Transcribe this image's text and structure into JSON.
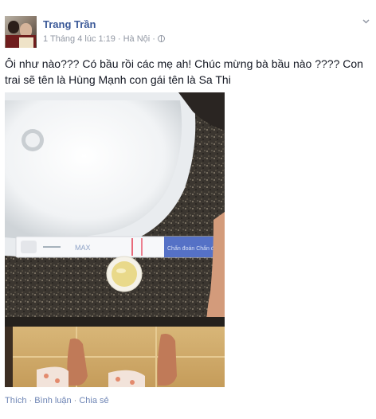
{
  "post": {
    "author": "Trang Trần",
    "date": "1 Tháng 4 lúc 1:19",
    "separator": "·",
    "location": "Hà Nội",
    "status_text": "Ôi như nào??? Có bầu rồi các mẹ ah! Chúc mừng bà bầu nào ???? Con trai sẽ tên là Hùng Mạnh con gái tên là Sa Thi",
    "privacy_icon": "globe-icon",
    "options_icon": "chevron-down-icon"
  },
  "photo": {
    "test_strip_label": "MAX",
    "test_strip_brand": "Chẩn đoán Chẩn đoán"
  },
  "actions": {
    "like": "Thích",
    "comment": "Bình luận",
    "share": "Chia sẻ",
    "separator": "·"
  },
  "colors": {
    "link_blue": "#3b5998",
    "meta_gray": "#9197a3",
    "action_blue": "#6d84b4",
    "text": "#141823"
  }
}
